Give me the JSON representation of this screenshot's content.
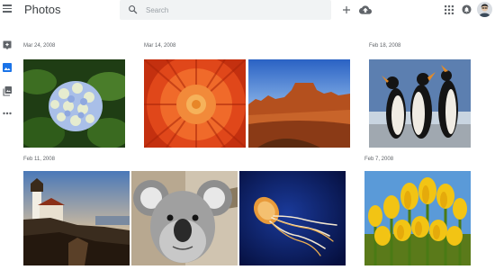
{
  "header": {
    "title": "Photos",
    "search_placeholder": "Search",
    "icons": [
      "menu-icon",
      "search-icon",
      "add-icon",
      "upload-icon",
      "apps-icon",
      "notifications-icon",
      "account-avatar"
    ]
  },
  "sidebar": {
    "items": [
      {
        "icon": "assistant-icon",
        "active": false
      },
      {
        "icon": "photos-icon",
        "active": true
      },
      {
        "icon": "albums-icon",
        "active": false
      },
      {
        "icon": "more-icon",
        "active": false
      }
    ]
  },
  "groups": [
    {
      "date": "Mar 24, 2008",
      "photos": [
        "Hydrangea"
      ]
    },
    {
      "date": "Mar 14, 2008",
      "photos": [
        "Chrysanthemum",
        "Desert"
      ]
    },
    {
      "date": "Feb 18, 2008",
      "photos": [
        "Penguins"
      ]
    },
    {
      "date": "Feb 11, 2008",
      "photos": [
        "Lighthouse",
        "Koala",
        "Jellyfish"
      ]
    },
    {
      "date": "Feb 7, 2008",
      "photos": [
        "Tulips"
      ]
    }
  ],
  "colors": {
    "accent": "#1a73e8",
    "icon_gray": "#5f6368",
    "search_bg": "#f1f3f4"
  }
}
